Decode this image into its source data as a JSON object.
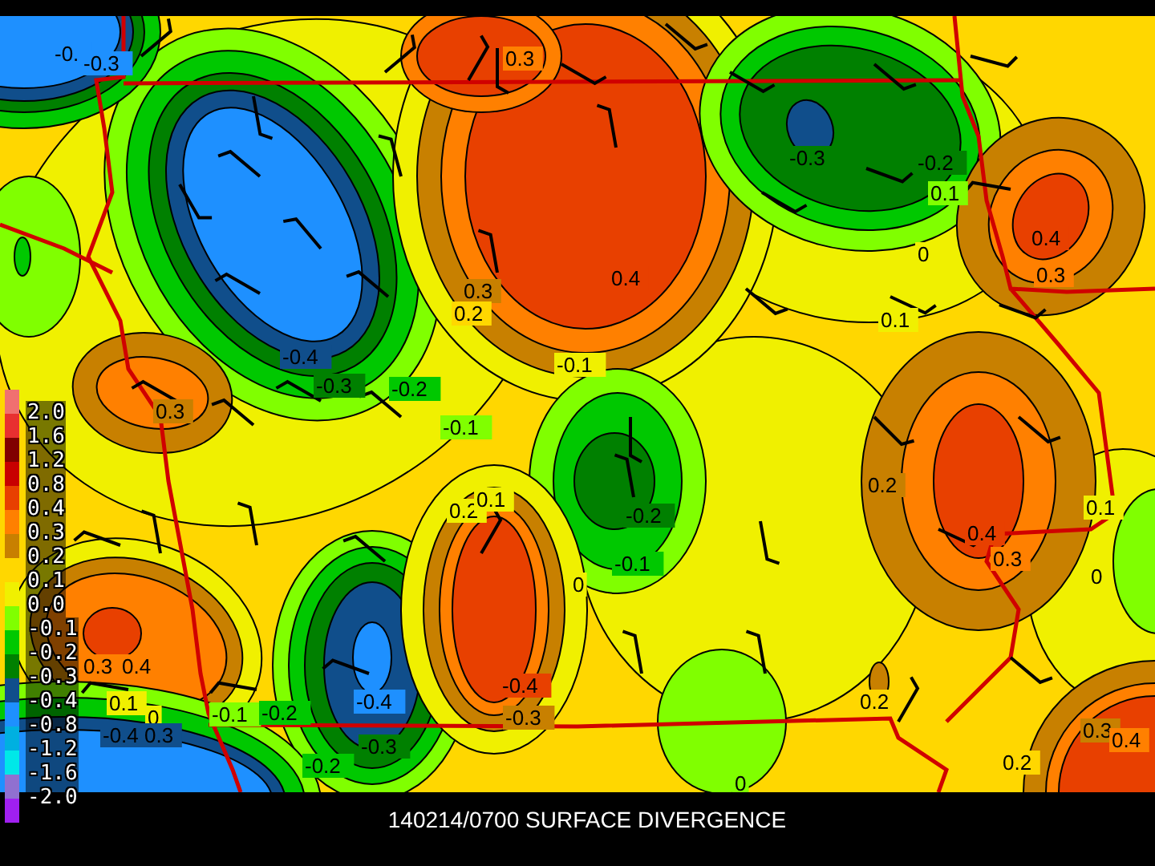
{
  "legend": {
    "labels": [
      "2.0",
      "1.6",
      "1.2",
      "0.8",
      "0.4",
      "0.3",
      "0.2",
      "0.1",
      "0.0",
      "-0.1",
      "-0.2",
      "-0.3",
      "-0.4",
      "-0.8",
      "-1.2",
      "-1.6",
      "-2.0"
    ],
    "segments": [
      {
        "color": "#f07070"
      },
      {
        "color": "#e83030"
      },
      {
        "color": "#800000"
      },
      {
        "color": "#c80000"
      },
      {
        "color": "#e84000"
      },
      {
        "color": "#ff8000"
      },
      {
        "color": "#c88000"
      },
      {
        "color": "#ffd700"
      },
      {
        "color": "#f0f000"
      },
      {
        "color": "#80ff00"
      },
      {
        "color": "#00c800"
      },
      {
        "color": "#008000"
      },
      {
        "color": "#104e8b"
      },
      {
        "color": "#1e90ff"
      },
      {
        "color": "#00b0e0"
      },
      {
        "color": "#00e8e8"
      },
      {
        "color": "#9070d0"
      },
      {
        "color": "#a020f0"
      }
    ]
  },
  "contour_labels": [
    "-0.",
    "-0.3",
    "0.3",
    "-0.3",
    "-0.2",
    "0.1",
    "0.4",
    "0.3",
    "0",
    "0.1",
    "0.4",
    "0.3",
    "0.2",
    "-0.4",
    "-0.3",
    "-0.2",
    "-0.1",
    "-0.1",
    "0.3",
    "0.2",
    "0.1",
    "-0.2",
    "-0.1",
    "0",
    "0.2",
    "0.4",
    "0.3",
    "0.1",
    "0",
    "0.3",
    "0.4",
    "0.1",
    "0",
    "-0.4",
    "0.3",
    "-0.1",
    "-0.2",
    "-0.4",
    "-0.3",
    "-0.2",
    "-0.4",
    "-0.3",
    "0.2",
    "0",
    "0.2",
    "0.3",
    "0.4"
  ],
  "title": "140214/0700 SURFACE DIVERGENCE"
}
